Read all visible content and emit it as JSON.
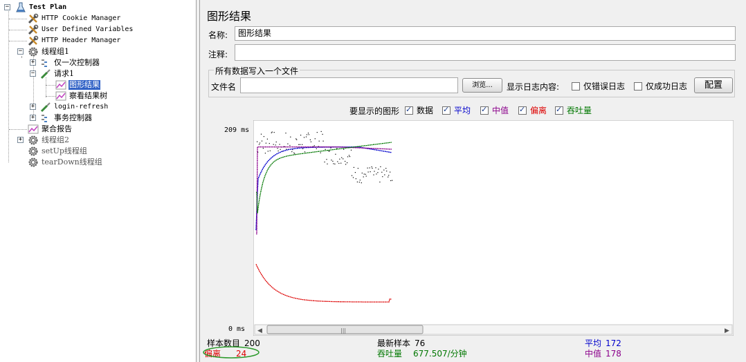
{
  "tree": {
    "test_plan": "Test Plan",
    "cookie_manager": "HTTP Cookie Manager",
    "user_vars": "User Defined Variables",
    "header_manager": "HTTP Header Manager",
    "thread_group_1": "线程组1",
    "once_controller": "仅一次控制器",
    "request_1": "请求1",
    "graph_results": "图形结果",
    "view_results_tree": "察看结果树",
    "login_refresh": "login-refresh",
    "transaction_controller": "事务控制器",
    "aggregate_report": "聚合报告",
    "thread_group_2": "线程组2",
    "setup_group": "setUp线程组",
    "teardown_group": "tearDown线程组"
  },
  "panel": {
    "title": "图形结果",
    "name_label": "名称:",
    "name_value": "图形结果",
    "comment_label": "注释:",
    "comment_value": "",
    "file_group_title": "所有数据写入一个文件",
    "filename_label": "文件名",
    "filename_value": "",
    "browse_button": "浏览...",
    "log_content_label": "显示日志内容:",
    "errors_only_label": "仅错误日志",
    "success_only_label": "仅成功日志",
    "configure_button": "配置",
    "graphs_to_display_label": "要显示的图形",
    "series_toggles": [
      {
        "label": "数据",
        "color": "#000000",
        "checked": true
      },
      {
        "label": "平均",
        "color": "#0000cc",
        "checked": true
      },
      {
        "label": "中值",
        "color": "#8b008b",
        "checked": true
      },
      {
        "label": "偏离",
        "color": "#dd0000",
        "checked": true
      },
      {
        "label": "吞吐量",
        "color": "#007700",
        "checked": true
      }
    ]
  },
  "chart_data": {
    "type": "scatter",
    "y_unit": "ms",
    "y_top_label": "209 ms",
    "y_bottom_label": "0 ms",
    "ylim": [
      0,
      209
    ],
    "x": "sample index",
    "series": [
      {
        "name": "数据",
        "color": "#000000"
      },
      {
        "name": "平均",
        "color": "#0000cc"
      },
      {
        "name": "中值",
        "color": "#8b008b"
      },
      {
        "name": "偏离",
        "color": "#dd0000"
      },
      {
        "name": "吞吐量",
        "color": "#007700"
      }
    ]
  },
  "stats": {
    "sample_count_label": "样本数目",
    "sample_count": "200",
    "latest_sample_label": "最新样本",
    "latest_sample": "76",
    "average_label": "平均",
    "average": "172",
    "deviation_label": "偏离",
    "deviation": "24",
    "throughput_label": "吞吐量",
    "throughput": "677.507/分钟",
    "median_label": "中值",
    "median": "178"
  },
  "colors": {
    "selection": "#3162c6",
    "average": "#0000cc",
    "median": "#8b008b",
    "deviation": "#dd0000",
    "throughput": "#007700",
    "deviation_circle": "#2a9a2a"
  }
}
